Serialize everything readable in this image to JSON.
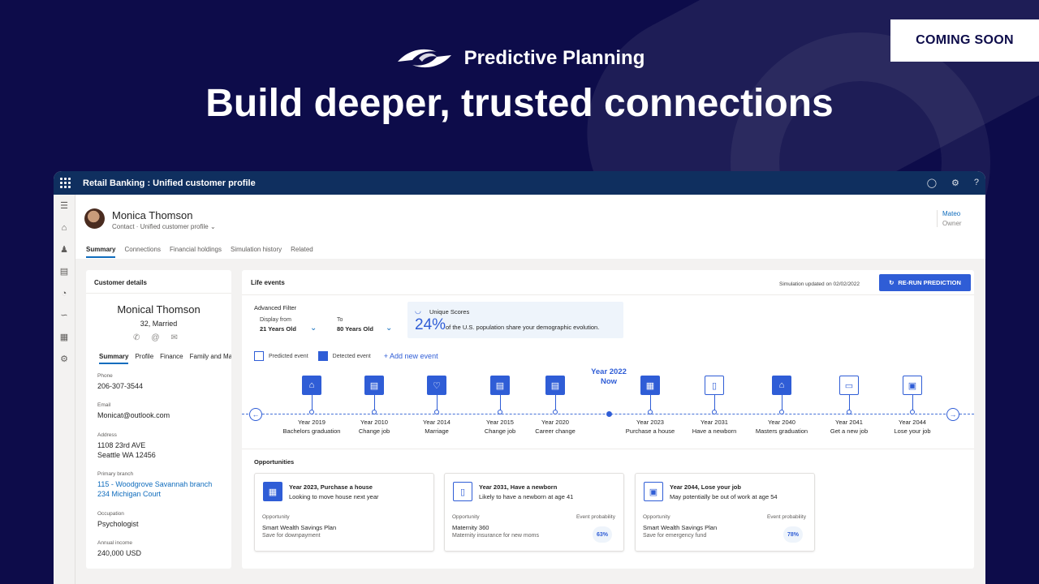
{
  "banner": {
    "badge": "COMING SOON",
    "brand": "Predictive Planning",
    "headline": "Build deeper, trusted connections"
  },
  "app": {
    "title": "Retail Banking : Unified customer profile",
    "top_icons": [
      "bell-icon",
      "gear-icon",
      "help-icon"
    ],
    "contact": {
      "name": "Monica Thomson",
      "type": "Contact",
      "form": "Unified customer profile"
    },
    "owner": {
      "name": "Mateo",
      "role": "Owner"
    },
    "tabs": [
      "Summary",
      "Connections",
      "Financial holdings",
      "Simulation history",
      "Related"
    ],
    "customer": {
      "header": "Customer details",
      "name": "Monical Thomson",
      "age_status": "32, Married",
      "subtabs": [
        "Summary",
        "Profile",
        "Finance",
        "Family and Ma"
      ],
      "phone_label": "Phone",
      "phone": "206-307-3544",
      "email_label": "Email",
      "email": "Monicat@outlook.com",
      "address_label": "Address",
      "address1": "1108 23rd AVE",
      "address2": "Seattle WA 12456",
      "branch_label": "Primary branch",
      "branch1": "115 - Woodgrove Savannah branch",
      "branch2": "234 Michigan Court",
      "occupation_label": "Occupation",
      "occupation": "Psychologist",
      "income_label": "Annual income",
      "income": "240,000 USD"
    },
    "life": {
      "header": "Life events",
      "sim_updated": "Simulation updated on 02/02/2022",
      "rerun": "RE-RUN PREDICTION",
      "filter_title": "Advanced Filter",
      "from_label": "Display from",
      "from_value": "21 Years Old",
      "to_label": "To",
      "to_value": "80 Years Old",
      "unique_title": "Unique Scores",
      "unique_pct": "24%",
      "unique_desc": "of the U.S. population share your demographic evolution.",
      "legend_predicted": "Predicted event",
      "legend_detected": "Detected event",
      "add_event": "Add new event",
      "now_year": "Year 2022",
      "now_label": "Now",
      "events": [
        {
          "year": "Year 2019",
          "name": "Bachelors graduation",
          "kind": "detected",
          "icon": "graduation-icon"
        },
        {
          "year": "Year 2010",
          "name": "Change job",
          "kind": "detected",
          "icon": "briefcase-icon"
        },
        {
          "year": "Year 2014",
          "name": "Marriage",
          "kind": "detected",
          "icon": "heart-icon"
        },
        {
          "year": "Year 2015",
          "name": "Change job",
          "kind": "detected",
          "icon": "briefcase-icon"
        },
        {
          "year": "Year 2020",
          "name": "Career change",
          "kind": "detected",
          "icon": "briefcase-icon"
        },
        {
          "year": "Year 2023",
          "name": "Purchase a house",
          "kind": "detected",
          "icon": "building-icon"
        },
        {
          "year": "Year 2031",
          "name": "Have a newborn",
          "kind": "predicted",
          "icon": "bottle-icon"
        },
        {
          "year": "Year 2040",
          "name": "Masters graduation",
          "kind": "detected",
          "icon": "graduation-icon"
        },
        {
          "year": "Year 2041",
          "name": "Get a new job",
          "kind": "predicted",
          "icon": "money-icon"
        },
        {
          "year": "Year 2044",
          "name": "Lose your job",
          "kind": "predicted",
          "icon": "document-icon"
        }
      ],
      "opp_header": "Opportunities",
      "opportunities": [
        {
          "title": "Year 2023, Purchase a house",
          "subtitle": "Looking to move house next year",
          "opp_label": "Opportunity",
          "name": "Smart Wealth Savings Plan",
          "desc": "Save for downpayment",
          "prob_label": "",
          "prob": "",
          "kind": "detected"
        },
        {
          "title": "Year 2031, Have a newborn",
          "subtitle": "Likely to have a newborn at age 41",
          "opp_label": "Opportunity",
          "name": "Maternity 360",
          "desc": "Maternity insurance for new moms",
          "prob_label": "Event probability",
          "prob": "63%",
          "kind": "predicted"
        },
        {
          "title": "Year 2044, Lose your job",
          "subtitle": "May potentially be out of work at age 54",
          "opp_label": "Opportunity",
          "name": "Smart Wealth Savings Plan",
          "desc": "Save for emergency fund",
          "prob_label": "Event probability",
          "prob": "78%",
          "kind": "predicted"
        }
      ]
    }
  }
}
